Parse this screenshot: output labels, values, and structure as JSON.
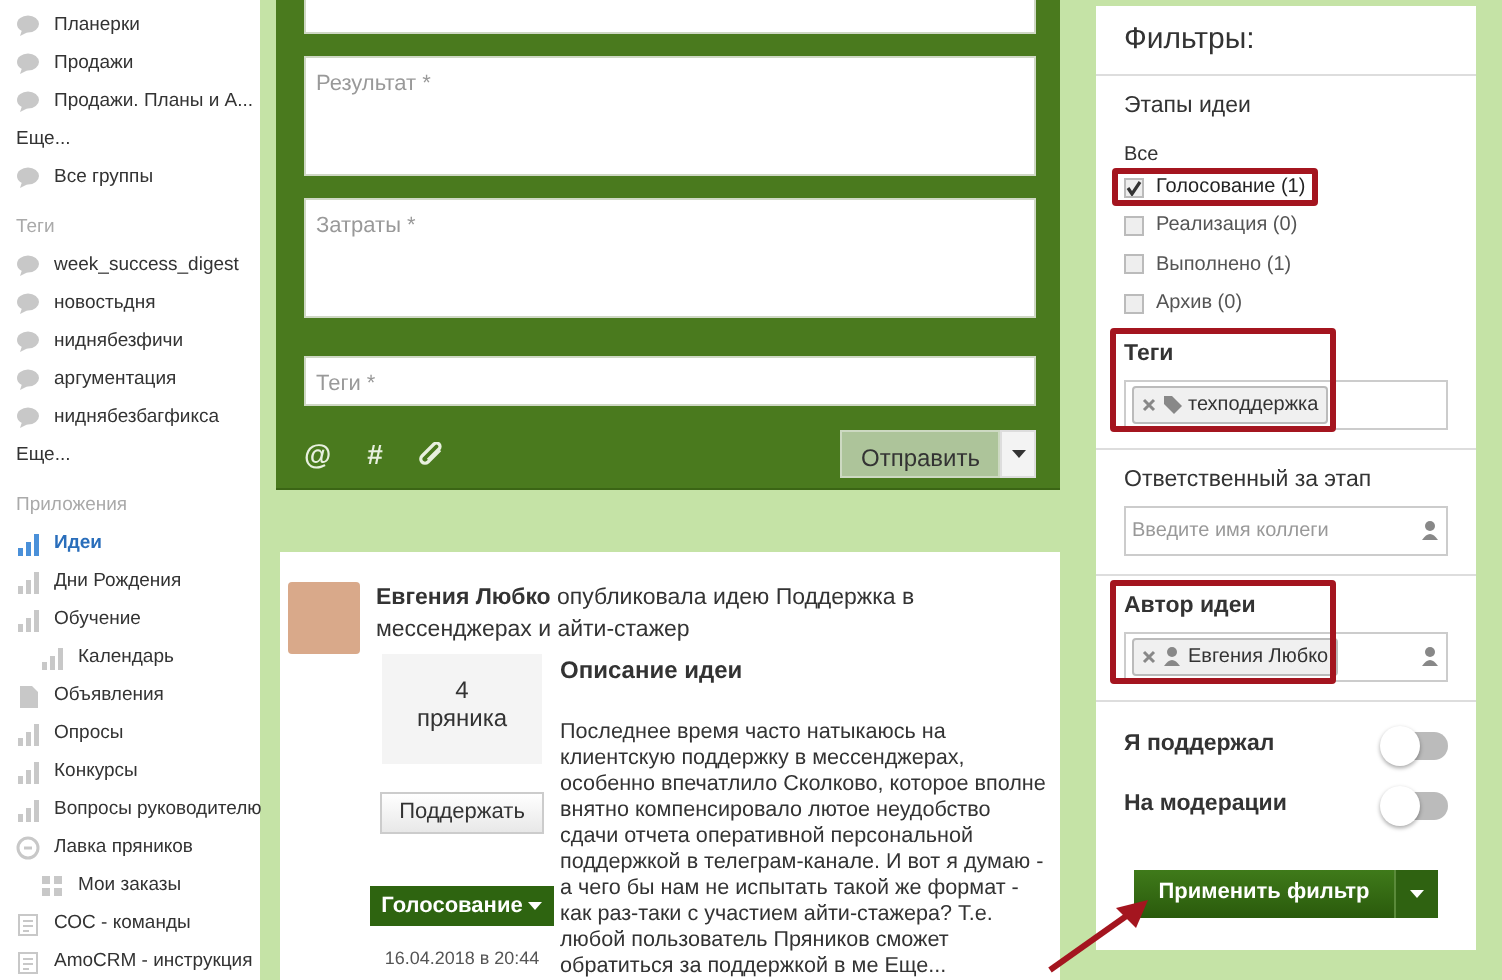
{
  "sidebar": {
    "sections": [
      {
        "items": [
          {
            "label": "Планерки",
            "kind": "chat",
            "selected": false
          },
          {
            "label": "Продажи",
            "kind": "chat",
            "selected": false
          },
          {
            "label": "Продажи. Планы и А...",
            "kind": "chat",
            "selected": false
          },
          {
            "label": "Еще...",
            "kind": "more",
            "selected": false
          },
          {
            "label": "Все группы",
            "kind": "chat",
            "selected": false
          }
        ]
      },
      {
        "heading": "Теги",
        "items": [
          {
            "label": "week_success_digest",
            "kind": "chat",
            "selected": false
          },
          {
            "label": "новостьдня",
            "kind": "chat",
            "selected": false
          },
          {
            "label": "ниднябезфичи",
            "kind": "chat",
            "selected": false
          },
          {
            "label": "аргументация",
            "kind": "chat",
            "selected": false
          },
          {
            "label": "ниднябезбагфикса",
            "kind": "chat",
            "selected": false
          },
          {
            "label": "Еще...",
            "kind": "more",
            "selected": false
          }
        ]
      },
      {
        "heading": "Приложения",
        "items": [
          {
            "label": "Идеи",
            "kind": "chart",
            "selected": true
          },
          {
            "label": "Дни Рождения",
            "kind": "chart",
            "selected": false
          },
          {
            "label": "Обучение",
            "kind": "chart",
            "selected": false,
            "children": [
              {
                "label": "Календарь",
                "kind": "chart",
                "selected": false
              }
            ]
          },
          {
            "label": "Объявления",
            "kind": "doc",
            "selected": false
          },
          {
            "label": "Опросы",
            "kind": "chart",
            "selected": false
          },
          {
            "label": "Конкурсы",
            "kind": "chart",
            "selected": false
          },
          {
            "label": "Вопросы руководителю",
            "kind": "chart",
            "selected": false
          },
          {
            "label": "Лавка пряников",
            "kind": "shop",
            "selected": false,
            "children": [
              {
                "label": "Мои заказы",
                "kind": "grid",
                "selected": false
              }
            ]
          },
          {
            "label": "СОС - команды",
            "kind": "list",
            "selected": false
          },
          {
            "label": "AmoCRM - инструкция",
            "kind": "list",
            "selected": false
          }
        ]
      }
    ]
  },
  "form": {
    "fields": [
      {
        "kind": "cut"
      },
      {
        "kind": "textarea",
        "placeholder": "Результат *"
      },
      {
        "kind": "textarea",
        "placeholder": "Затраты *"
      },
      {
        "kind": "input",
        "placeholder": "Теги *"
      }
    ],
    "tools": [
      "@",
      "#"
    ],
    "submit_button": "Отправить"
  },
  "post": {
    "headline": "**Евгения Любко** опубликовала идею Поддержка в мессенджерах и айти-стажер",
    "likes_count": "4",
    "likes_unit": "пряника",
    "support_button": "Поддержать",
    "stage_button": "Голосование",
    "date": "16.04.2018 в 20:44",
    "description_title": "Описание идеи",
    "description": "Последнее время часто натыкаюсь на клиентскую поддержку в мессенджерах, особенно впечатлило Сколково, которое вполне внятно компенсировало лютое неудобство сдачи отчета оперативной персональной поддержкой в телеграм-канале. И вот я думаю - а чего бы нам не испытать такой же формат - как раз-таки с участием айти-стажера? Т.е. любой пользователь Пряников сможет обратиться за поддержкой в ме",
    "more_link": "Еще..."
  },
  "filters": {
    "title": "Фильтры:",
    "stages": {
      "heading": "Этапы идеи",
      "all_label": "Все",
      "items": [
        {
          "label": "Голосование (1)",
          "checked": true,
          "highlighted": true
        },
        {
          "label": "Реализация (0)",
          "checked": false,
          "highlighted": false
        },
        {
          "label": "Выполнено (1)",
          "checked": false,
          "highlighted": false
        },
        {
          "label": "Архив (0)",
          "checked": false,
          "highlighted": false
        }
      ]
    },
    "tags": {
      "heading": "Теги",
      "highlighted": true,
      "chips": [
        "техподдержка"
      ]
    },
    "responsible": {
      "heading": "Ответственный за этап",
      "placeholder": "Введите имя коллеги"
    },
    "author": {
      "heading": "Автор идеи",
      "highlighted": true,
      "chips": [
        "Евгения Любко"
      ]
    },
    "toggles": [
      {
        "label": "Я поддержал",
        "on": false
      },
      {
        "label": "На модерации",
        "on": false
      }
    ],
    "apply_button": "Применить фильтр"
  }
}
